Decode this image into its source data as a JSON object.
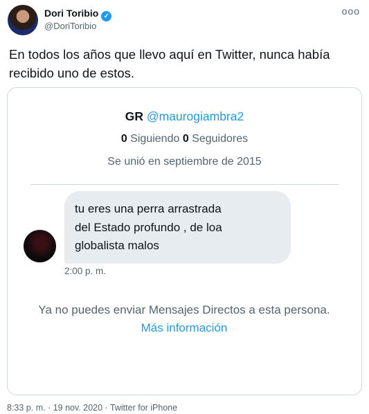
{
  "author": {
    "name": "Dori Toribio",
    "handle": "@DoriToribio",
    "verified_icon": "✓"
  },
  "more_icon": "ooo",
  "tweet_text": "En todos los años que llevo aquí en Twitter, nunca había recibido uno de estos.",
  "dm_card": {
    "profile_name": "GR",
    "profile_handle": "@maurogiambra2",
    "following_count": "0",
    "following_label": "Siguiendo",
    "followers_count": "0",
    "followers_label": "Seguidores",
    "joined": "Se unió en septiembre de 2015",
    "message_line1": "tu eres una perra arrastrada",
    "message_line2": "del Estado profundo , de loa",
    "message_line3": "globalista malos",
    "message_time": "2:00 p. m.",
    "notice_text": "Ya no puedes enviar Mensajes Directos a esta persona.",
    "notice_link": "Más información"
  },
  "footer": "8:33 p. m. · 19 nov. 2020 · Twitter for iPhone"
}
